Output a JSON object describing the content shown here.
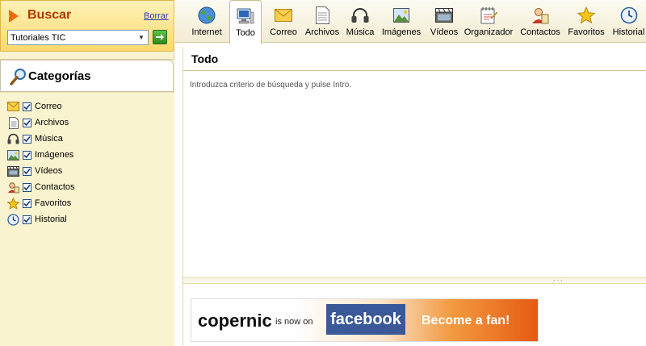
{
  "search": {
    "title": "Buscar",
    "clear_label": "Borrar",
    "query": "Tutoriales TIC"
  },
  "categories": {
    "title": "Categorías",
    "items": [
      {
        "label": "Correo",
        "icon": "envelope-icon",
        "checked": true
      },
      {
        "label": "Archivos",
        "icon": "document-icon",
        "checked": true
      },
      {
        "label": "Música",
        "icon": "headphones-icon",
        "checked": true
      },
      {
        "label": "Imágenes",
        "icon": "picture-icon",
        "checked": true
      },
      {
        "label": "Vídeos",
        "icon": "film-icon",
        "checked": true
      },
      {
        "label": "Contactos",
        "icon": "contact-icon",
        "checked": true
      },
      {
        "label": "Favoritos",
        "icon": "star-icon",
        "checked": true
      },
      {
        "label": "Historial",
        "icon": "clock-icon",
        "checked": true
      }
    ]
  },
  "toolbar": {
    "tabs": [
      {
        "label": "Internet",
        "icon": "globe-icon"
      },
      {
        "label": "Todo",
        "icon": "computer-icon",
        "active": true
      },
      {
        "label": "Correo",
        "icon": "envelope-icon"
      },
      {
        "label": "Archivos",
        "icon": "document-icon"
      },
      {
        "label": "Música",
        "icon": "headphones-icon"
      },
      {
        "label": "Imágenes",
        "icon": "picture-icon"
      },
      {
        "label": "Vídeos",
        "icon": "film-icon"
      },
      {
        "label": "Organizador",
        "icon": "organizer-icon"
      },
      {
        "label": "Contactos",
        "icon": "contact-icon"
      },
      {
        "label": "Favoritos",
        "icon": "star-icon"
      },
      {
        "label": "Historial",
        "icon": "clock-icon"
      }
    ]
  },
  "main": {
    "title": "Todo",
    "hint": "Introduzca criterio de búsqueda y pulse Intro."
  },
  "banner": {
    "brand": "copernic",
    "middle": "is now on",
    "facebook": "facebook",
    "cta": "Become a fan!"
  },
  "colors": {
    "accent_orange": "#e86a10",
    "sidebar_bg": "#faf3cf",
    "facebook_blue": "#3b5998"
  }
}
